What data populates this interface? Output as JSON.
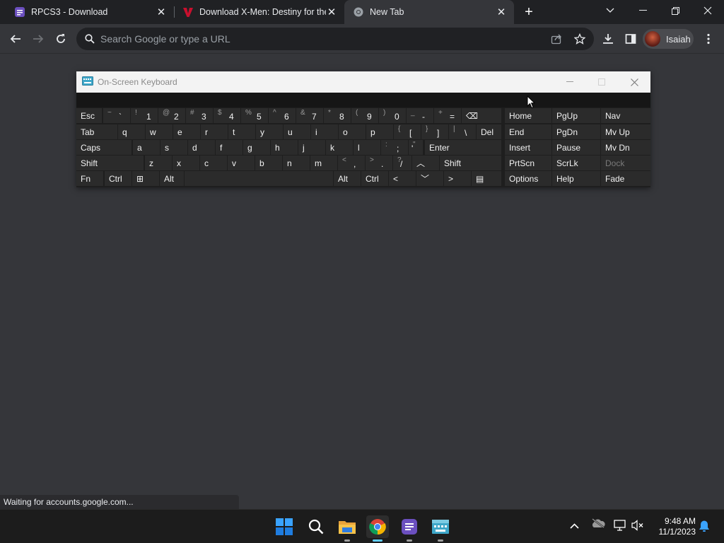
{
  "tabs": [
    {
      "title": "RPCS3 - Download",
      "close": "✕"
    },
    {
      "title": "Download X-Men: Destiny for the",
      "close": "✕"
    },
    {
      "title": "New Tab",
      "close": "✕"
    }
  ],
  "new_tab_glyph": "+",
  "window_controls": {
    "dropdown": "⌄",
    "minimize": "—",
    "restore": "❐",
    "close": "✕"
  },
  "omnibox": {
    "placeholder": "Search Google or type a URL"
  },
  "profile": {
    "name": "Isaiah"
  },
  "osk": {
    "title": "On-Screen Keyboard",
    "rows": [
      [
        {
          "p": "Esc"
        },
        {
          "s": "~",
          "p": "`"
        },
        {
          "s": "!",
          "p": "1"
        },
        {
          "s": "@",
          "p": "2"
        },
        {
          "s": "#",
          "p": "3"
        },
        {
          "s": "$",
          "p": "4"
        },
        {
          "s": "%",
          "p": "5"
        },
        {
          "s": "^",
          "p": "6"
        },
        {
          "s": "&",
          "p": "7"
        },
        {
          "s": "*",
          "p": "8"
        },
        {
          "s": "(",
          "p": "9"
        },
        {
          "s": ")",
          "p": "0"
        },
        {
          "s": "_",
          "p": "-"
        },
        {
          "s": "+",
          "p": "="
        },
        {
          "p": "⌫"
        }
      ],
      [
        {
          "p": "Tab"
        },
        {
          "p": "q"
        },
        {
          "p": "w"
        },
        {
          "p": "e"
        },
        {
          "p": "r"
        },
        {
          "p": "t"
        },
        {
          "p": "y"
        },
        {
          "p": "u"
        },
        {
          "p": "i"
        },
        {
          "p": "o"
        },
        {
          "p": "p"
        },
        {
          "s": "{",
          "p": "["
        },
        {
          "s": "}",
          "p": "]"
        },
        {
          "s": "|",
          "p": "\\"
        },
        {
          "p": "Del"
        }
      ],
      [
        {
          "p": "Caps"
        },
        {
          "p": "a"
        },
        {
          "p": "s"
        },
        {
          "p": "d"
        },
        {
          "p": "f"
        },
        {
          "p": "g"
        },
        {
          "p": "h"
        },
        {
          "p": "j"
        },
        {
          "p": "k"
        },
        {
          "p": "l"
        },
        {
          "s": ":",
          "p": ";"
        },
        {
          "s": "\"",
          "p": "'"
        },
        {
          "p": "Enter"
        }
      ],
      [
        {
          "p": "Shift"
        },
        {
          "p": "z"
        },
        {
          "p": "x"
        },
        {
          "p": "c"
        },
        {
          "p": "v"
        },
        {
          "p": "b"
        },
        {
          "p": "n"
        },
        {
          "p": "m"
        },
        {
          "s": "<",
          "p": ","
        },
        {
          "s": ">",
          "p": "."
        },
        {
          "s": "?",
          "p": "/"
        },
        {
          "p": "︿"
        },
        {
          "p": "Shift"
        }
      ],
      [
        {
          "p": "Fn"
        },
        {
          "p": "Ctrl"
        },
        {
          "p": "⊞"
        },
        {
          "p": "Alt"
        },
        {
          "p": ""
        },
        {
          "p": "Alt"
        },
        {
          "p": "Ctrl"
        },
        {
          "p": "<"
        },
        {
          "p": "﹀"
        },
        {
          "p": ">"
        },
        {
          "p": "▤"
        }
      ]
    ],
    "nav_keys": [
      [
        "Home",
        "PgUp",
        "Nav"
      ],
      [
        "End",
        "PgDn",
        "Mv Up"
      ],
      [
        "Insert",
        "Pause",
        "Mv Dn"
      ],
      [
        "PrtScn",
        "ScrLk",
        "Dock"
      ],
      [
        "Options",
        "Help",
        "Fade"
      ]
    ]
  },
  "status_text": "Waiting for accounts.google.com...",
  "taskbar": {
    "apps": [
      "start",
      "search",
      "file-explorer",
      "chrome",
      "rpcs3",
      "on-screen-keyboard"
    ]
  },
  "clock": {
    "time": "9:48 AM",
    "date": "11/1/2023"
  }
}
